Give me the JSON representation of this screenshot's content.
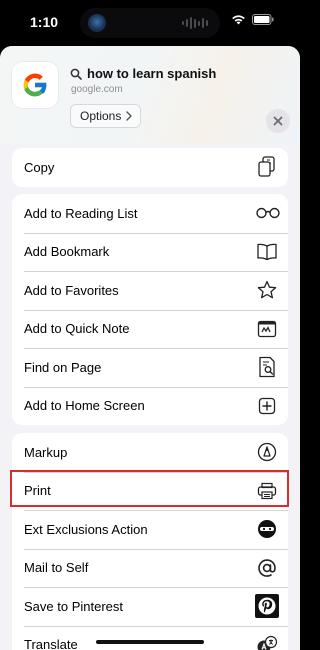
{
  "status_bar": {
    "time": "1:10"
  },
  "header": {
    "query": "how to learn spanish",
    "site": "google.com",
    "options_label": "Options"
  },
  "groups": [
    {
      "items": [
        {
          "label": "Copy",
          "icon": "copy-icon"
        }
      ]
    },
    {
      "items": [
        {
          "label": "Add to Reading List",
          "icon": "glasses-icon"
        },
        {
          "label": "Add Bookmark",
          "icon": "book-icon"
        },
        {
          "label": "Add to Favorites",
          "icon": "star-icon"
        },
        {
          "label": "Add to Quick Note",
          "icon": "quick-note-icon"
        },
        {
          "label": "Find on Page",
          "icon": "find-on-page-icon"
        },
        {
          "label": "Add to Home Screen",
          "icon": "add-square-icon"
        }
      ]
    },
    {
      "items": [
        {
          "label": "Markup",
          "icon": "markup-pen-icon"
        },
        {
          "label": "Print",
          "icon": "printer-icon"
        },
        {
          "label": "Ext Exclusions Action",
          "icon": "mask-icon"
        },
        {
          "label": "Mail to Self",
          "icon": "at-icon"
        },
        {
          "label": "Save to Pinterest",
          "icon": "pinterest-icon"
        },
        {
          "label": "Translate",
          "icon": "translate-icon"
        }
      ]
    }
  ],
  "colors": {
    "highlight": "#d32f2f",
    "sheet_bg": "#f2f2f7"
  }
}
